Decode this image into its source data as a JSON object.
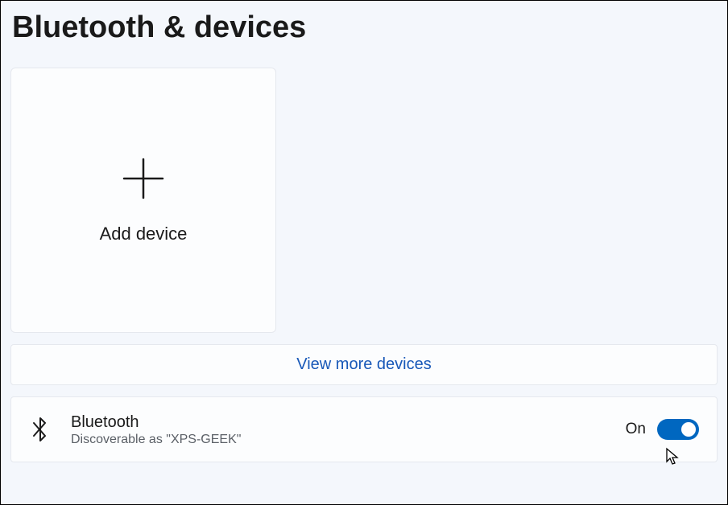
{
  "page": {
    "title": "Bluetooth & devices"
  },
  "addDevice": {
    "label": "Add device"
  },
  "viewMore": {
    "label": "View more devices"
  },
  "bluetooth": {
    "title": "Bluetooth",
    "subtitle": "Discoverable as \"XPS-GEEK\"",
    "toggleLabel": "On",
    "toggleState": true,
    "accentColor": "#0067c0"
  }
}
